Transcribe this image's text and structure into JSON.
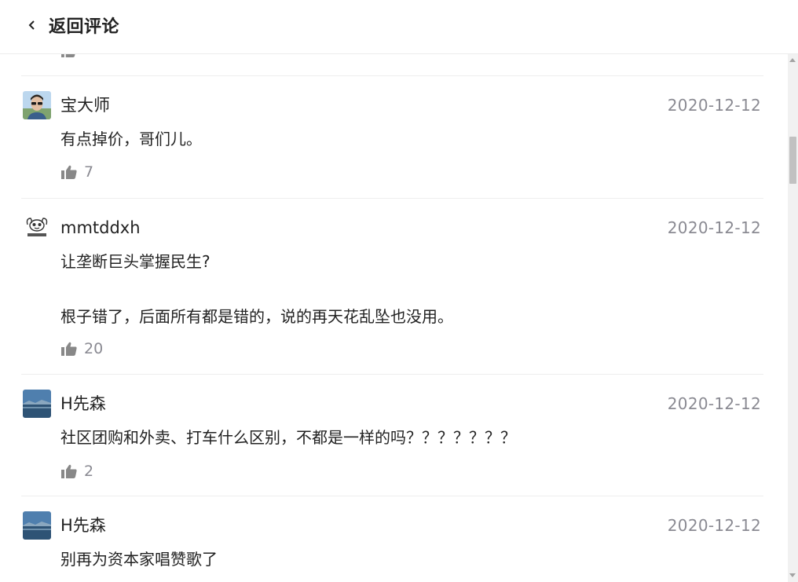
{
  "header": {
    "title": "返回评论",
    "back_icon": "chevron-left-icon"
  },
  "icons": {
    "like": "thumbs-up-icon"
  },
  "colors": {
    "text": "#222222",
    "muted": "#8a8a92",
    "divider": "#eeeeee",
    "icon": "#888888"
  },
  "comments": [
    {
      "user": "宝大师",
      "date": "2020-12-12",
      "text": [
        "有点掉价，哥们儿。"
      ],
      "likes": "7"
    },
    {
      "user": "mmtddxh",
      "date": "2020-12-12",
      "text": [
        "让垄断巨头掌握民生?",
        "根子错了，后面所有都是错的，说的再天花乱坠也没用。"
      ],
      "likes": "20"
    },
    {
      "user": "H先森",
      "date": "2020-12-12",
      "text": [
        "社区团购和外卖、打车什么区别，不都是一样的吗？？？？？？？"
      ],
      "likes": "2"
    },
    {
      "user": "H先森",
      "date": "2020-12-12",
      "text": [
        "别再为资本家唱赞歌了"
      ],
      "likes": ""
    }
  ]
}
